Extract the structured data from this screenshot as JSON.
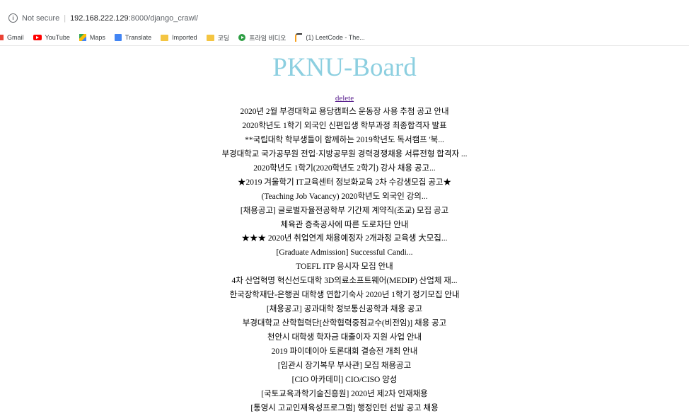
{
  "browser": {
    "security_label": "Not secure",
    "url_host": "192.168.222.129",
    "url_path": ":8000/django_crawl/",
    "bookmarks": [
      {
        "label": "Gmail",
        "icon": "gmail-icon"
      },
      {
        "label": "YouTube",
        "icon": "youtube-icon"
      },
      {
        "label": "Maps",
        "icon": "maps-icon"
      },
      {
        "label": "Translate",
        "icon": "translate-icon"
      },
      {
        "label": "Imported",
        "icon": "folder-icon"
      },
      {
        "label": "코딩",
        "icon": "folder-icon"
      },
      {
        "label": "프라임 비디오",
        "icon": "play-icon"
      },
      {
        "label": "(1) LeetCode - The...",
        "icon": "leetcode-icon"
      }
    ]
  },
  "page": {
    "title": "PKNU-Board",
    "delete_label": "delete",
    "posts": [
      "2020년 2월 부경대학교 용당캠퍼스 운동장 사용 추첨 공고 안내",
      "2020학년도 1학기 외국인 신편입생 학부과정 최종합격자 발표",
      "**국립대학 학부생들이 함께하는 2019학년도 독서캠프 '북...",
      "부경대학교 국가공무원 전입·지방공무원 경력경쟁채용 서류전형 합격자 ...",
      "2020학년도 1학기(2020학년도 2학기) 강사 채용 공고...",
      "★2019 겨울학기 IT교육센터 정보화교육 2차 수강생모집 공고★",
      "(Teaching Job Vacancy) 2020학년도 외국인 강의...",
      "[채용공고] 글로벌자율전공학부 기간제 계약직(조교) 모집 공고",
      "체육관 증축공사에 따른 도로차단 안내",
      "★★★ 2020년 취업연계 채용예정자 2개과정 교육생 大모집...",
      "[Graduate Admission] Successful Candi...",
      "TOEFL ITP 응시자 모집 안내",
      "4차 산업혁명 혁신선도대학 3D의료소프트웨어(MEDIP) 산업체 재...",
      "한국장학재단-은행권 대학생 연합기숙사 2020년 1학기 정기모집 안내",
      "[채용공고] 공과대학 정보통신공학과 채용 공고",
      "부경대학교 산학협력단[산학협력중점교수(비전임)] 채용 공고",
      "천안시 대학생 학자금 대출이자 지원 사업 안내",
      "2019 파이데이아 토론대회 결승전 개최 안내",
      "[임관시 장기복무 부사관] 모집 채용공고",
      "[CIO 아카데미] CIO/CISO 양성",
      "[국토교육과학기술진흥원] 2020년 제2차 인재채용",
      "[통영시 고교인재육성프로그램] 행정인턴 선발 공고 채용"
    ]
  },
  "colors": {
    "title": "#8ccfe0",
    "link_visited": "#551a8b"
  }
}
